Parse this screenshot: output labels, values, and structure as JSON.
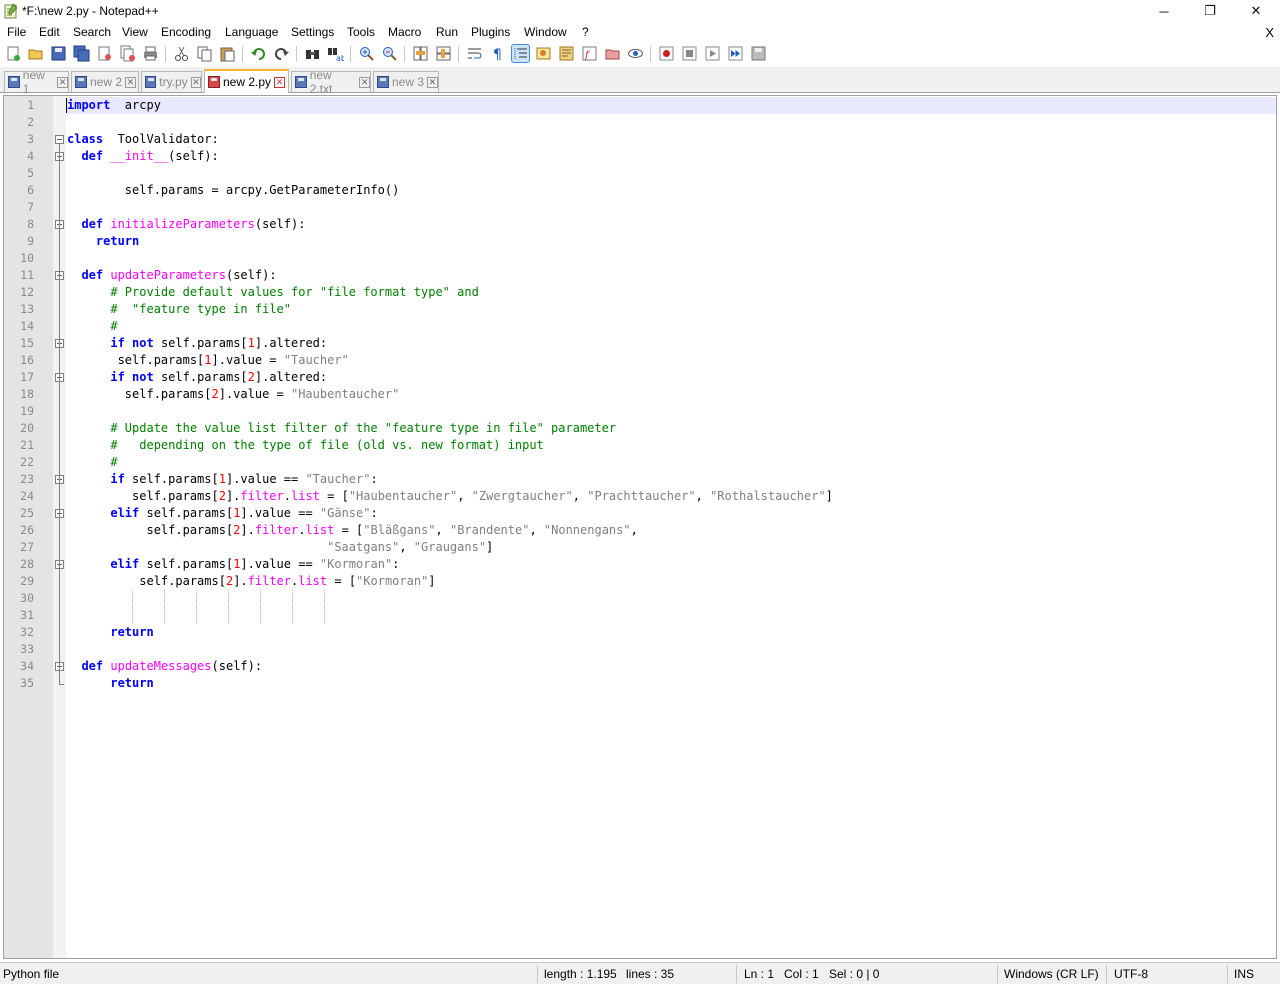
{
  "window": {
    "title": "*F:\\new 2.py - Notepad++",
    "minimize_icon": "minimize-icon",
    "maximize_icon": "restore-icon",
    "close_icon": "close-icon",
    "min_glyph": "─",
    "restore_glyph": "❐",
    "close_glyph": "✕"
  },
  "menu": {
    "items": [
      "File",
      "Edit",
      "Search",
      "View",
      "Encoding",
      "Language",
      "Settings",
      "Tools",
      "Macro",
      "Run",
      "Plugins",
      "Window",
      "?"
    ],
    "close_doc": "X"
  },
  "toolbar": {
    "buttons": [
      "new-file",
      "open-file",
      "save",
      "save-all",
      "close",
      "close-all",
      "print",
      "cut",
      "copy",
      "paste",
      "undo",
      "redo",
      "find",
      "replace",
      "zoom-in",
      "zoom-out",
      "sync-vertical",
      "sync-horizontal",
      "word-wrap",
      "show-all-chars",
      "indent-guide",
      "user-defined-lang",
      "doc-map",
      "function-list",
      "folder-as-workspace",
      "monitoring",
      "record-macro",
      "stop-record",
      "play-macro",
      "run-macro-multiple",
      "save-macro"
    ]
  },
  "tabs": [
    {
      "label": "new 1",
      "active": false
    },
    {
      "label": "new 2",
      "active": false
    },
    {
      "label": "try.py",
      "active": false
    },
    {
      "label": "new 2.py",
      "active": true
    },
    {
      "label": "new 2.txt",
      "active": false
    },
    {
      "label": "new 3",
      "active": false
    }
  ],
  "tab_close_glyph": "✕",
  "editor": {
    "line_count": 35,
    "current_line": 1,
    "lines": [
      [
        [
          "kw",
          "import"
        ],
        [
          "",
          "  arcpy"
        ]
      ],
      [],
      [
        [
          "kw",
          "class"
        ],
        [
          "",
          "  ToolValidator:"
        ]
      ],
      [
        [
          "",
          "  "
        ],
        [
          "kw",
          "def"
        ],
        [
          "",
          ""
        ],
        [
          "fn",
          " __init__"
        ],
        [
          "",
          "(self):"
        ]
      ],
      [],
      [
        [
          "",
          "        self.params = arcpy.GetParameterInfo()"
        ]
      ],
      [],
      [
        [
          "",
          "  "
        ],
        [
          "kw",
          "def"
        ],
        [
          "fn",
          " initializeParameters"
        ],
        [
          "",
          "(self):"
        ]
      ],
      [
        [
          "",
          "    "
        ],
        [
          "kw",
          "return"
        ]
      ],
      [],
      [
        [
          "",
          "  "
        ],
        [
          "kw",
          "def"
        ],
        [
          "fn",
          " updateParameters"
        ],
        [
          "",
          "(self):"
        ]
      ],
      [
        [
          "cm",
          "      # Provide default values for \"file format type\" and"
        ]
      ],
      [
        [
          "cm",
          "      #  \"feature type in file\""
        ]
      ],
      [
        [
          "cm",
          "      #"
        ]
      ],
      [
        [
          "",
          "      "
        ],
        [
          "kw",
          "if not"
        ],
        [
          "",
          "",
          " self.params["
        ],
        [
          "nm",
          "1"
        ],
        [
          "",
          "].altered:"
        ]
      ],
      [
        [
          "",
          "       self.params["
        ],
        [
          "nm",
          "1"
        ],
        [
          "",
          "].value = "
        ],
        [
          "st",
          "\"Taucher\""
        ]
      ],
      [
        [
          "",
          "      "
        ],
        [
          "kw",
          "if not"
        ],
        [
          "",
          "",
          " self.params["
        ],
        [
          "nm",
          "2"
        ],
        [
          "",
          "].altered:"
        ]
      ],
      [
        [
          "",
          "        self.params["
        ],
        [
          "nm",
          "2"
        ],
        [
          "",
          "].value = "
        ],
        [
          "st",
          "\"Haubentaucher\""
        ]
      ],
      [],
      [
        [
          "cm",
          "      # Update the value list filter of the \"feature type in file\" parameter"
        ]
      ],
      [
        [
          "cm",
          "      #   depending on the type of file (old vs. new format) input"
        ]
      ],
      [
        [
          "cm",
          "      #"
        ]
      ],
      [
        [
          "",
          "      "
        ],
        [
          "kw",
          "if"
        ],
        [
          "",
          " self.params["
        ],
        [
          "nm",
          "1"
        ],
        [
          "",
          "].value == "
        ],
        [
          "st",
          "\"Taucher\""
        ],
        [
          "",
          ":"
        ]
      ],
      [
        [
          "",
          "         self.params["
        ],
        [
          "nm",
          "2"
        ],
        [
          "",
          "]."
        ],
        [
          "fn",
          "filter"
        ],
        [
          "",
          "."
        ],
        [
          "fn",
          "list"
        ],
        [
          "",
          " = ["
        ],
        [
          "st",
          "\"Haubentaucher\""
        ],
        [
          "",
          ", "
        ],
        [
          "st",
          "\"Zwergtaucher\""
        ],
        [
          "",
          ", "
        ],
        [
          "st",
          "\"Prachttaucher\""
        ],
        [
          "",
          ", "
        ],
        [
          "st",
          "\"Rothalstaucher\""
        ],
        [
          "",
          "]"
        ]
      ],
      [
        [
          "",
          "      "
        ],
        [
          "kw",
          "elif"
        ],
        [
          "",
          " self.params["
        ],
        [
          "nm",
          "1"
        ],
        [
          "",
          "].value == "
        ],
        [
          "st",
          "\"Gänse\""
        ],
        [
          "",
          ":"
        ]
      ],
      [
        [
          "",
          "           self.params["
        ],
        [
          "nm",
          "2"
        ],
        [
          "",
          "]."
        ],
        [
          "fn",
          "filter"
        ],
        [
          "",
          "."
        ],
        [
          "fn",
          "list"
        ],
        [
          "",
          " = ["
        ],
        [
          "st",
          "\"Bläßgans\""
        ],
        [
          "",
          ", "
        ],
        [
          "st",
          "\"Brandente\""
        ],
        [
          "",
          ", "
        ],
        [
          "st",
          "\"Nonnengans\""
        ],
        [
          "",
          ","
        ]
      ],
      [
        [
          "",
          "                                    "
        ],
        [
          "st",
          "\"Saatgans\""
        ],
        [
          "",
          ", "
        ],
        [
          "st",
          "\"Graugans\""
        ],
        [
          "",
          "]"
        ]
      ],
      [
        [
          "",
          "      "
        ],
        [
          "kw",
          "elif"
        ],
        [
          "",
          " self.params["
        ],
        [
          "nm",
          "1"
        ],
        [
          "",
          "].value == "
        ],
        [
          "st",
          "\"Kormoran\""
        ],
        [
          "",
          ":"
        ]
      ],
      [
        [
          "",
          "          self.params["
        ],
        [
          "nm",
          "2"
        ],
        [
          "",
          "]."
        ],
        [
          "fn",
          "filter"
        ],
        [
          "",
          "."
        ],
        [
          "fn",
          "list"
        ],
        [
          "",
          " = ["
        ],
        [
          "st",
          "\"Kormoran\""
        ],
        [
          "",
          "]"
        ]
      ],
      [],
      [],
      [
        [
          "",
          "      "
        ],
        [
          "kw",
          "return"
        ]
      ],
      [],
      [
        [
          "",
          "  "
        ],
        [
          "kw",
          "def"
        ],
        [
          "fn",
          " updateMessages"
        ],
        [
          "",
          "(self):"
        ]
      ],
      [
        [
          "",
          "      "
        ],
        [
          "kw",
          "return"
        ]
      ]
    ]
  },
  "status": {
    "file_type": "Python file",
    "length": "length : 1.195",
    "lines": "lines : 35",
    "ln": "Ln : 1",
    "col": "Col : 1",
    "sel": "Sel : 0 | 0",
    "eol": "Windows (CR LF)",
    "encoding": "UTF-8",
    "mode": "INS"
  }
}
